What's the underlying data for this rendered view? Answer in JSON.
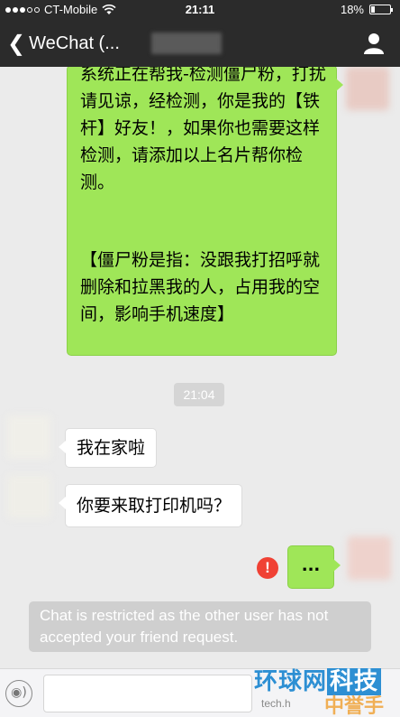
{
  "status_bar": {
    "carrier": "CT-Mobile",
    "time": "21:11",
    "battery_percent": "18%",
    "battery_level": 0.18
  },
  "nav": {
    "title": "WeChat (..."
  },
  "messages": {
    "long_part1": "系统正在帮我-检测僵尸粉，打扰请见谅，经检测，你是我的【铁杆】好友！，如果你也需要这样检测，请添加以上名片帮你检测。",
    "long_part2": "【僵尸粉是指：没跟我打招呼就删除和拉黑我的人，占用我的空间，影响手机速度】",
    "timestamp": "21:04",
    "msg_home": "我在家啦",
    "msg_printer": "你要来取打印机吗？",
    "msg_dots": "...",
    "error_mark": "!",
    "system_notice": "Chat is restricted as the other user has not accepted your friend request."
  },
  "watermarks": {
    "brand_prefix": "环球网",
    "brand_box": "科技",
    "url": "tech.h",
    "corner_logo": "中誉手游网"
  },
  "colors": {
    "header_bg": "#2b2b2b",
    "chat_bg": "#ebebeb",
    "sent_bubble": "#9fe658",
    "error_red": "#f04134"
  }
}
